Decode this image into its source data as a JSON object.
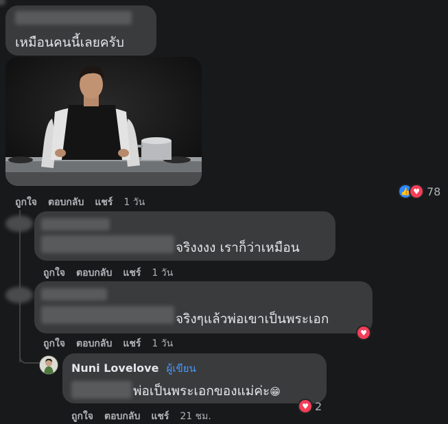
{
  "comment1": {
    "text": "เหมือนคนนี้เลยครับ",
    "actions": {
      "like": "ถูกใจ",
      "reply": "ตอบกลับ",
      "share": "แชร์",
      "time": "1 วัน"
    },
    "reactions": {
      "icons": [
        "like-icon",
        "love-icon"
      ],
      "count": "78"
    }
  },
  "reply1": {
    "text": "จริงงงง เราก็ว่าเหมือน",
    "actions": {
      "like": "ถูกใจ",
      "reply": "ตอบกลับ",
      "share": "แชร์",
      "time": "1 วัน"
    }
  },
  "reply2": {
    "text": "จริงๆแล้วพ่อเขาเป็นพระเอก",
    "actions": {
      "like": "ถูกใจ",
      "reply": "ตอบกลับ",
      "share": "แชร์",
      "time": "1 วัน"
    },
    "reactions": {
      "icons": [
        "love-icon"
      ]
    }
  },
  "reply3": {
    "author": "Nuni Lovelove",
    "badge": "ผู้เขียน",
    "text": "พ่อเป็นพระเอกของแม่ค่ะ",
    "emoji": "😁",
    "actions": {
      "like": "ถูกใจ",
      "reply": "ตอบกลับ",
      "share": "แชร์",
      "time": "21 ชม."
    },
    "reactions": {
      "icons": [
        "love-icon"
      ],
      "count": "2"
    }
  },
  "colors": {
    "background": "#18191a",
    "bubble": "#3a3b3c",
    "link": "#4599ff",
    "like": "#2d88ff",
    "love": "#f33e58"
  }
}
